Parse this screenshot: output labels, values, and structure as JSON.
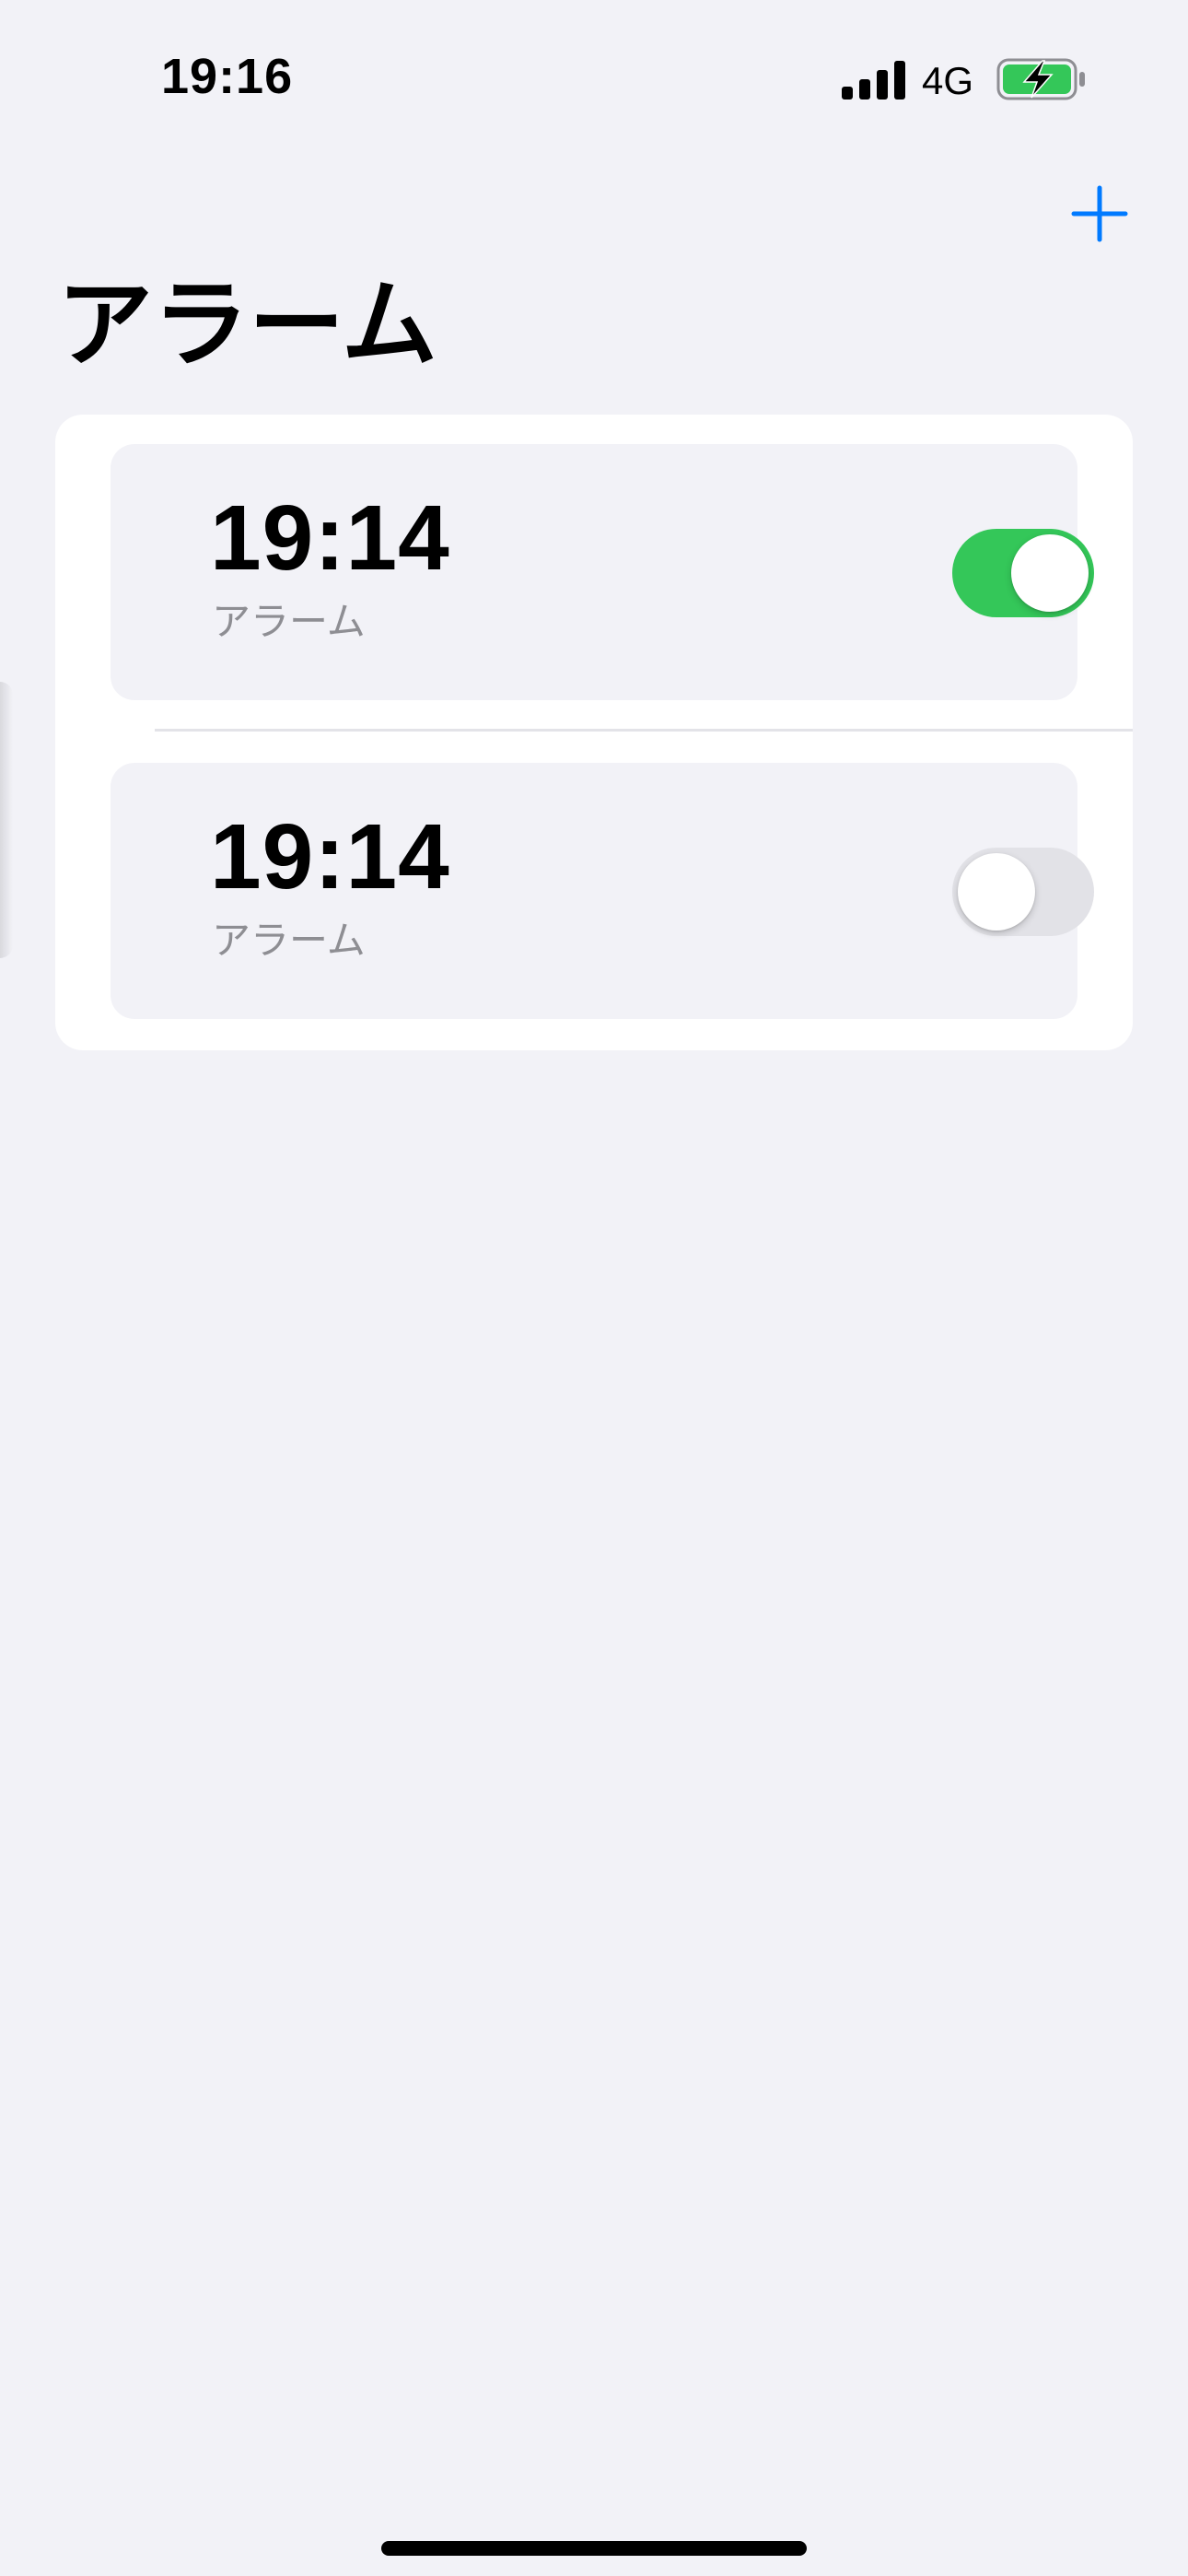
{
  "status_bar": {
    "time": "19:16",
    "network": "4G",
    "signal_icon": "signal-bars-icon",
    "battery_icon": "battery-charging-icon",
    "battery_color": "#34c759"
  },
  "nav": {
    "add_icon": "plus-icon",
    "accent_color": "#007aff"
  },
  "page": {
    "title": "アラーム"
  },
  "alarms": [
    {
      "time": "19:14",
      "label": "アラーム",
      "enabled": true
    },
    {
      "time": "19:14",
      "label": "アラーム",
      "enabled": false
    }
  ],
  "colors": {
    "toggle_on": "#34c759",
    "toggle_off": "#e2e2e7",
    "background": "#f2f2f7",
    "secondary_text": "#8e8e93"
  }
}
